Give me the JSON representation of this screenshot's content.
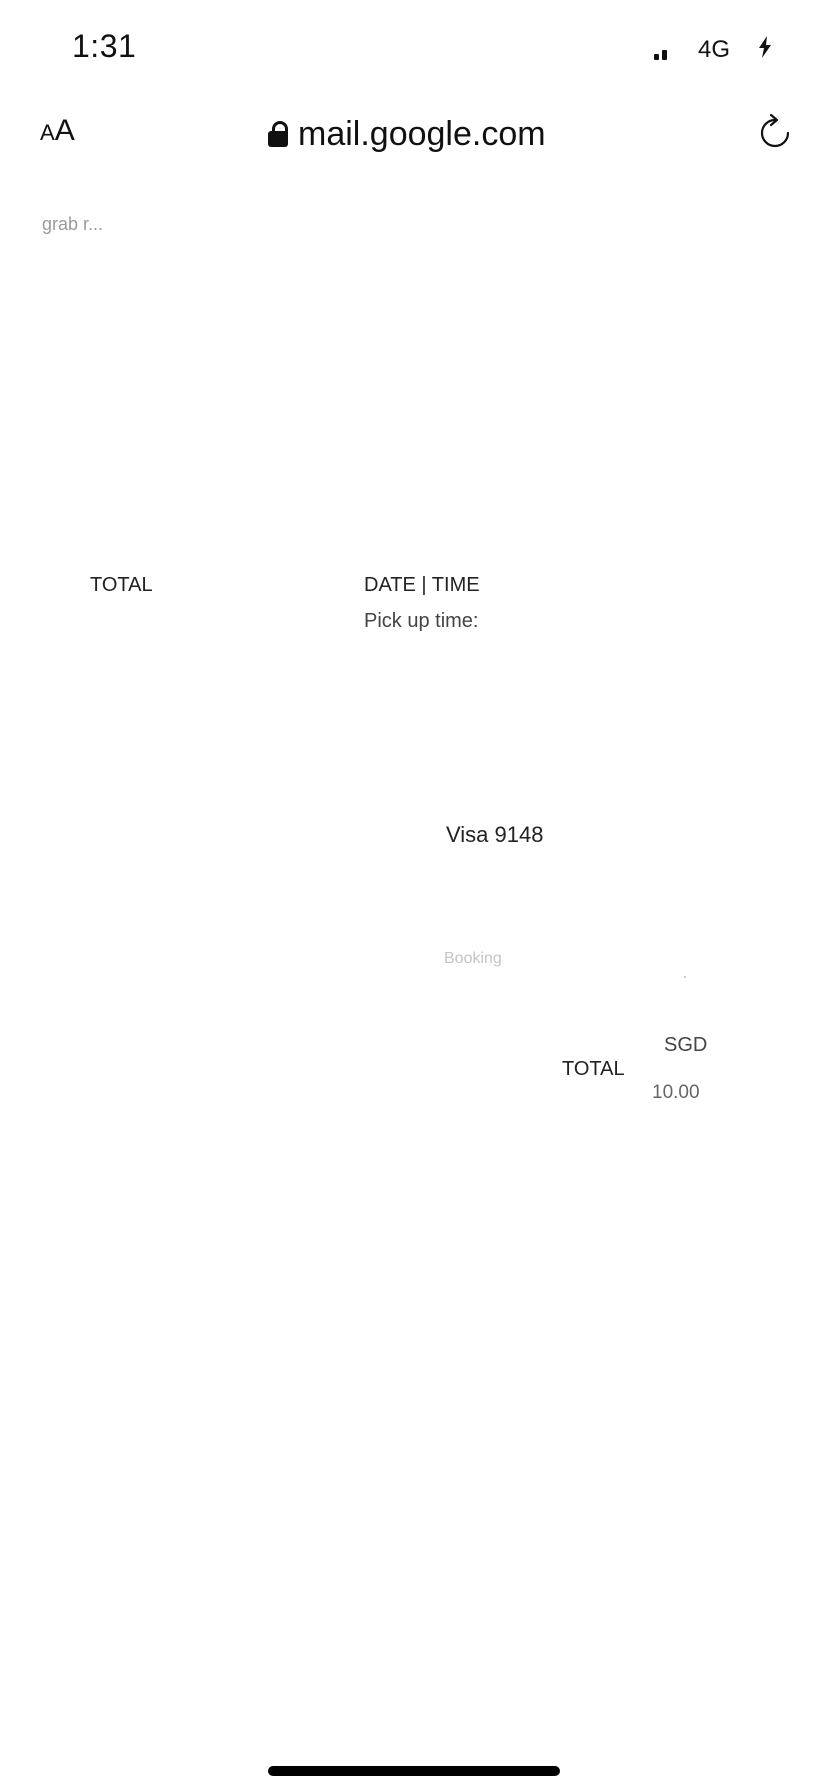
{
  "status_bar": {
    "time": "1:31",
    "network": "4G",
    "charging_icon": "bolt-icon"
  },
  "address_bar": {
    "text_size_small": "A",
    "text_size_large": "A",
    "url": "mail.google.com",
    "lock_icon": "lock-icon",
    "reload_icon": "reload-icon"
  },
  "content": {
    "faint_header": "grab r...",
    "total_left": "TOTAL",
    "date_time": "DATE | TIME",
    "pickup": "Pick up time:",
    "payment": "Visa  9148",
    "faint_label": "Booking",
    "currency": "SGD",
    "total_right": "TOTAL",
    "amount": "10.00"
  },
  "colors": {
    "background": "#ffffff",
    "text": "#111111",
    "home_indicator": "#000000"
  }
}
